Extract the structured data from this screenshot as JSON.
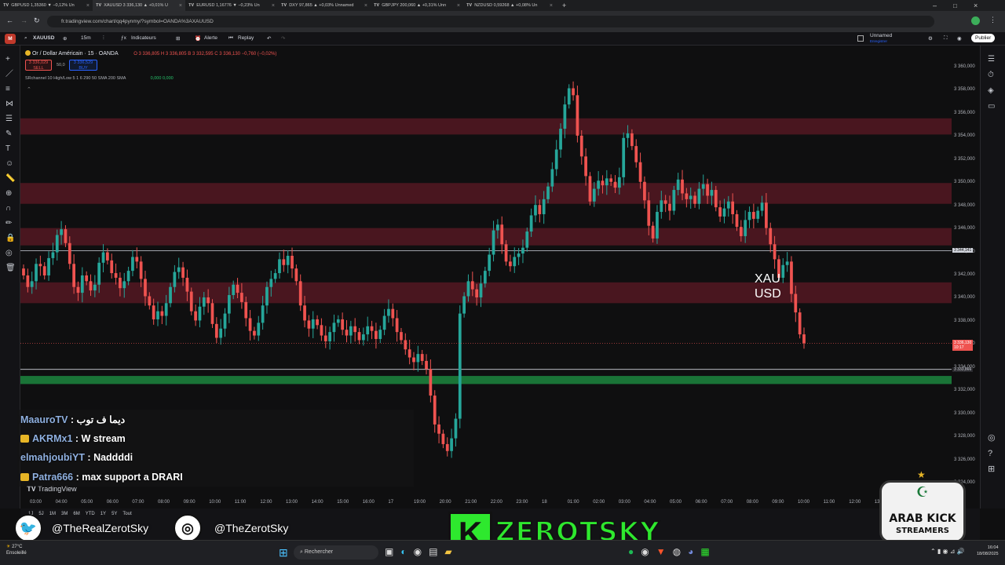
{
  "browser": {
    "tabs": [
      {
        "label": "GBPUSD 1,35360 ▼ −0,12% Un"
      },
      {
        "label": "XAUUSD 3 336,130 ▲ +0,01% U"
      },
      {
        "label": "EURUSD 1,16776 ▼ −0,23% Un"
      },
      {
        "label": "DXY 97,865 ▲ +0,03% Unnamed"
      },
      {
        "label": "GBPJPY 200,060 ▲ +0,31% Unn"
      },
      {
        "label": "NZDUSD 0,59268 ▲ +0,08% Un"
      }
    ],
    "url": "fr.tradingview.com/chart/qq4pynmy/?symbol=OANDA%3AXAUUSD"
  },
  "toolbar": {
    "symbol": "XAUUSD",
    "interval": "15m",
    "indicators": "Indicateurs",
    "alert": "Alerte",
    "replay": "Replay",
    "layout_name": "Unnamed",
    "layout_sub": "Enregistrer",
    "publish": "Publier"
  },
  "legend": {
    "title": "Or / Dollar Américain · 15 · OANDA",
    "ohlc": "O 3 336,805  H 3 336,805  B 3 332,595  C 3 336,130  −0,760 (−0,02%)",
    "sell_price": "3 336,029",
    "sell_label": "SELL",
    "spread": "50,0",
    "buy_price": "3 336,529",
    "buy_label": "BUY",
    "indicator": "SRchannel 10 High/Low 5 1 6 290 50 SMA 200 SMA",
    "indicator_values": "0,000  0,000"
  },
  "price_axis": {
    "ticks": [
      "3 360,000",
      "3 358,000",
      "3 356,000",
      "3 354,000",
      "3 352,000",
      "3 350,000",
      "3 348,000",
      "3 346,000",
      "3 344,000",
      "3 342,000",
      "3 340,000",
      "3 338,000",
      "3 336,000",
      "3 334,000",
      "3 332,000",
      "3 330,000",
      "3 328,000",
      "3 326,000",
      "3 324,000"
    ],
    "ref_top": "3 344,141",
    "current_price": "3 336,130",
    "countdown": "10:17",
    "ref_bottom": "3 333,866"
  },
  "time_axis": {
    "ticks": [
      "03:00",
      "04:00",
      "05:00",
      "06:00",
      "07:00",
      "08:00",
      "09:00",
      "10:00",
      "11:00",
      "12:00",
      "13:00",
      "14:00",
      "15:00",
      "16:00",
      "17",
      "19:00",
      "20:00",
      "21:00",
      "22:00",
      "23:00",
      "18",
      "01:00",
      "02:00",
      "03:00",
      "04:00",
      "05:00",
      "06:00",
      "07:00",
      "08:00",
      "09:00",
      "10:00",
      "11:00",
      "12:00",
      "13"
    ]
  },
  "range_buttons": [
    "1J",
    "5J",
    "1M",
    "3M",
    "6M",
    "YTD",
    "1Y",
    "5Y",
    "Tout"
  ],
  "watermark": {
    "line1": "XAU",
    "line2": "USD",
    "brand": "TradingView"
  },
  "chat": [
    {
      "user": "MaauroTV",
      "message": "ديما ف توب",
      "badge": false
    },
    {
      "user": "AKRMx1",
      "message": "W stream",
      "badge": true
    },
    {
      "user": "elmahjoubiYT",
      "message": "Naddddi",
      "badge": false
    },
    {
      "user": "Patra666",
      "message": "max support a DRARI",
      "badge": true
    }
  ],
  "socials": {
    "twitter": "@TheRealZerotSky",
    "instagram": "@TheZerotSky"
  },
  "brand": {
    "k": "K",
    "name": "ZEROTSKY"
  },
  "arab_kick": {
    "line1": "ARAB KICK",
    "line2": "STREAMERS"
  },
  "taskbar": {
    "weather_temp": "27°C",
    "weather_desc": "Ensoleillé",
    "search": "Rechercher",
    "time": "16:04",
    "date": "18/08/2025"
  },
  "chart_data": {
    "type": "candlestick",
    "ylim": [
      3323,
      3361
    ],
    "colors": {
      "up": "#26a69a",
      "down": "#ef5350",
      "zone_red": "#7a1e2c",
      "zone_green": "#1b7a3a"
    },
    "zones": [
      {
        "from": 3354.2,
        "to": 3355.6,
        "color": "red"
      },
      {
        "from": 3348.2,
        "to": 3350.0,
        "color": "red"
      },
      {
        "from": 3344.6,
        "to": 3346.1,
        "color": "red"
      },
      {
        "from": 3339.6,
        "to": 3341.4,
        "color": "red"
      },
      {
        "from": 3332.6,
        "to": 3333.3,
        "color": "green"
      }
    ],
    "hlines": [
      3344.14,
      3333.87
    ],
    "closes": [
      3342,
      3341,
      3341.5,
      3343,
      3342.8,
      3342,
      3343.5,
      3344,
      3345.5,
      3346,
      3344.8,
      3343,
      3341,
      3340.5,
      3342,
      3341.5,
      3340.7,
      3341.2,
      3343.1,
      3344,
      3343.3,
      3342.2,
      3341.8,
      3340.9,
      3341.5,
      3342.4,
      3343.6,
      3343.2,
      3341.7,
      3340.2,
      3339.4,
      3338.2,
      3338.9,
      3338.5,
      3339.6,
      3341,
      3342.3,
      3342.7,
      3341.8,
      3340.6,
      3338.9,
      3338.1,
      3339.3,
      3340.1,
      3339.6,
      3337.8,
      3336.6,
      3337.4,
      3338.7,
      3340.3,
      3341.2,
      3340.5,
      3339.7,
      3338.3,
      3337.2,
      3336.8,
      3337.9,
      3339.4,
      3341,
      3341.7,
      3342.2,
      3343.4,
      3342.9,
      3343.7,
      3342.6,
      3341.5,
      3339.4,
      3338.1,
      3337.4,
      3338.2,
      3337.7,
      3336.8,
      3336.3,
      3337.1,
      3337.9,
      3338.2,
      3337.3,
      3336.8,
      3337.6,
      3337.1,
      3336.4,
      3336.9,
      3337.6,
      3337.2,
      3336.5,
      3337.3,
      3338.5,
      3339.1,
      3338.3,
      3337.1,
      3336.4,
      3335.6,
      3334.9,
      3334.5,
      3335.2,
      3334.6,
      3333.9,
      3331.6,
      3329.1,
      3328.3,
      3327.4,
      3326.8,
      3327.9,
      3329.6,
      3338.7,
      3340.2,
      3341.5,
      3340.8,
      3340.1,
      3341.3,
      3342.4,
      3343.8,
      3345.9,
      3346.4,
      3344.7,
      3343.2,
      3342.8,
      3343.6,
      3343.9,
      3344.4,
      3345.8,
      3347.2,
      3348.1,
      3347.3,
      3348.6,
      3349.7,
      3351.2,
      3352.9,
      3354.7,
      3356.8,
      3358.2,
      3357.6,
      3354.1,
      3352.3,
      3350.6,
      3348.4,
      3349.5,
      3350.2,
      3349.8,
      3350.4,
      3350.1,
      3349.6,
      3350.5,
      3353.9,
      3354.3,
      3353.2,
      3351.8,
      3350.1,
      3348.5,
      3346.3,
      3345.2,
      3347.5,
      3348.5,
      3348.2,
      3347.6,
      3349.4,
      3350.3,
      3349.1,
      3348.6,
      3348.9,
      3348.2,
      3349.5,
      3349.9,
      3348.9,
      3349.4,
      3347.9,
      3347.1,
      3347.8,
      3348.4,
      3347.3,
      3346.2,
      3345.4,
      3346.8,
      3347.5,
      3346.9,
      3347.6,
      3348.3,
      3346.1,
      3344.7,
      3343.4,
      3341.8,
      3342.9,
      3343.2,
      3340.4,
      3338.8,
      3336.9,
      3336.13
    ]
  }
}
